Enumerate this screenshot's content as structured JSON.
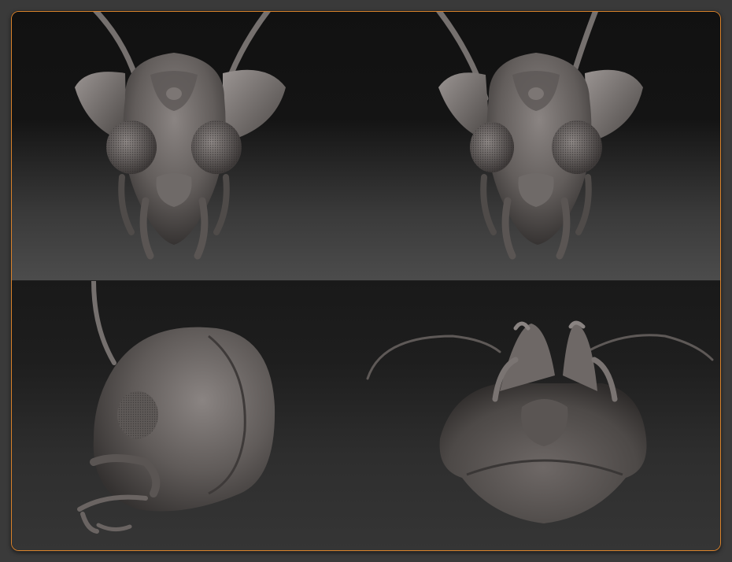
{
  "render": {
    "views": [
      {
        "id": "front-left",
        "icon": "insect-head-front-icon"
      },
      {
        "id": "front-right",
        "icon": "insect-head-front-icon"
      },
      {
        "id": "side",
        "icon": "insect-head-side-icon"
      },
      {
        "id": "underside",
        "icon": "insect-head-underside-icon"
      }
    ],
    "colors": {
      "frame_border": "#d9822b",
      "page_background": "#3a3a3a",
      "model_clay": "#6e6866",
      "model_shadow": "#3b3837",
      "model_highlight": "#a8a2a0"
    }
  }
}
